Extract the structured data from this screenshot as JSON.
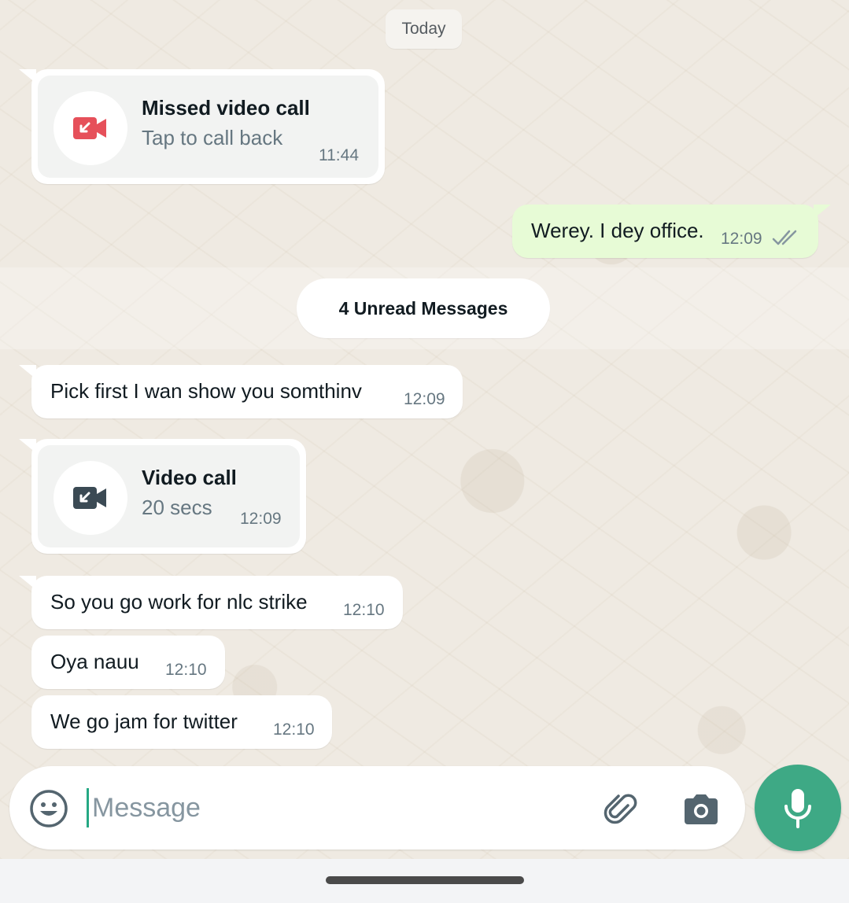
{
  "day_separator": "Today",
  "messages": {
    "missed_call": {
      "title": "Missed video call",
      "subtitle": "Tap to call back",
      "time": "11:44",
      "icon": "missed-video-call-icon",
      "icon_color": "#e6505a"
    },
    "outgoing_1": {
      "text": "Werey. I dey office.",
      "time": "12:09",
      "status_icon": "double-check-icon"
    },
    "unread_banner": "4 Unread Messages",
    "incoming_1": {
      "text": "Pick first I wan show you somthinv",
      "time": "12:09"
    },
    "video_call": {
      "title": "Video call",
      "subtitle": "20 secs",
      "time": "12:09",
      "icon": "video-call-icon",
      "icon_color": "#3b4a54"
    },
    "incoming_2": {
      "text": "So you go work for nlc strike",
      "time": "12:10"
    },
    "incoming_3": {
      "text": "Oya nauu",
      "time": "12:10"
    },
    "incoming_4": {
      "text": "We go jam for twitter",
      "time": "12:10"
    }
  },
  "composer": {
    "placeholder": "Message",
    "emoji_icon": "emoji-icon",
    "attach_icon": "paperclip-icon",
    "camera_icon": "camera-icon",
    "mic_icon": "microphone-icon"
  },
  "colors": {
    "accent": "#3ea985",
    "outgoing_bubble": "#e7fbd6",
    "chat_background": "#efeae2"
  }
}
